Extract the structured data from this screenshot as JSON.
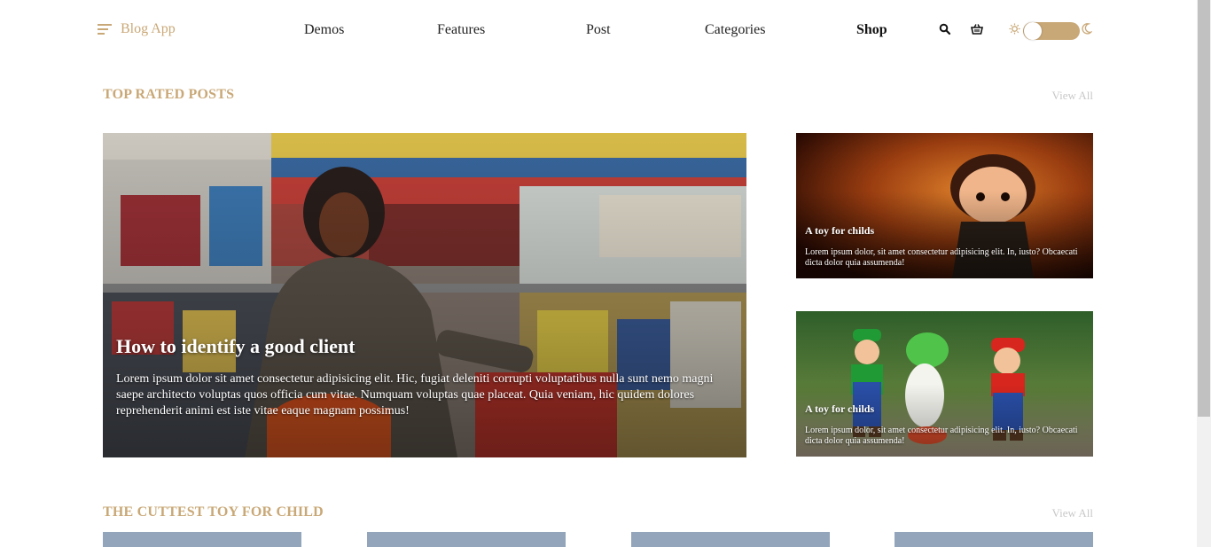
{
  "header": {
    "brand": "Blog App",
    "nav": [
      "Demos",
      "Features",
      "Post",
      "Categories",
      "Shop"
    ],
    "active_nav": "Shop",
    "icons": [
      "search-icon",
      "basket-icon",
      "sun-icon",
      "moon-icon"
    ]
  },
  "top_rated": {
    "title": "TOP RATED POSTS",
    "view_all": "View All",
    "hero": {
      "title": "How to identify a good client",
      "text": "Lorem ipsum dolor sit amet consectetur adipisicing elit. Hic, fugiat deleniti corrupti voluptatibus nulla sunt nemo magni saepe architecto voluptas quos officia cum vitae. Numquam voluptas quae placeat. Quia veniam, hic quidem dolores reprehenderit animi est iste vitae eaque magnam possimus!"
    },
    "cards": [
      {
        "title": "A toy for childs",
        "text": "Lorem ipsum dolor, sit amet consectetur adipisicing elit. In, iusto? Obcaecati dicta dolor quia assumenda!"
      },
      {
        "title": "A toy for childs",
        "text": "Lorem ipsum dolor, sit amet consectetur adipisicing elit. In, iusto? Obcaecati dicta dolor quia assumenda!"
      }
    ]
  },
  "cuttest": {
    "title": "THE CUTTEST TOY FOR CHILD",
    "view_all": "View All"
  },
  "colors": {
    "accent": "#c9a877",
    "muted": "#c8c8c8"
  }
}
